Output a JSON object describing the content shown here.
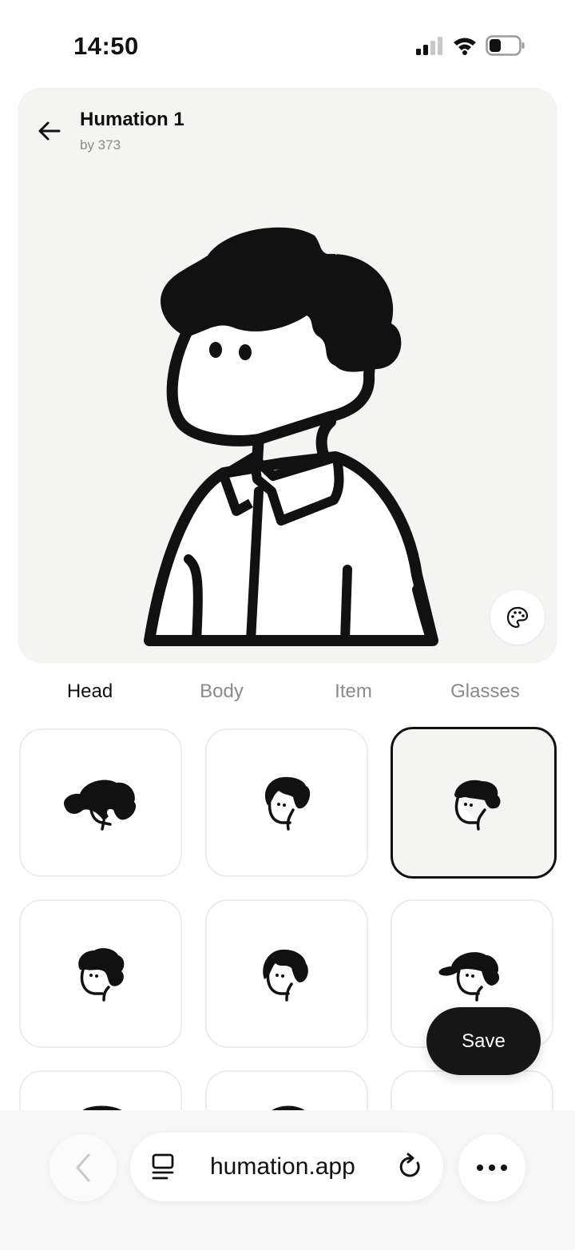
{
  "status_bar": {
    "time": "14:50",
    "signal_icon": "cellular-signal-icon",
    "wifi_icon": "wifi-icon",
    "battery_icon": "battery-icon"
  },
  "header": {
    "title": "Humation 1",
    "subtitle": "by 373",
    "back_icon": "arrow-left-icon"
  },
  "preview": {
    "palette_icon": "palette-icon",
    "background": "#f4f4f2"
  },
  "tabs": [
    {
      "label": "Head",
      "active": true
    },
    {
      "label": "Body",
      "active": false
    },
    {
      "label": "Item",
      "active": false
    },
    {
      "label": "Glasses",
      "active": false
    }
  ],
  "options": {
    "selected_index": 2,
    "count_visible": 9
  },
  "save_button": {
    "label": "Save"
  },
  "browser": {
    "url": "humation.app",
    "back_icon": "chevron-left-icon",
    "tabs_icon": "tabs-icon",
    "reload_icon": "reload-icon",
    "more_icon": "more-icon"
  },
  "colors": {
    "accent": "#161616",
    "text_muted": "#8a8a8a",
    "tile_border": "#ececea"
  }
}
